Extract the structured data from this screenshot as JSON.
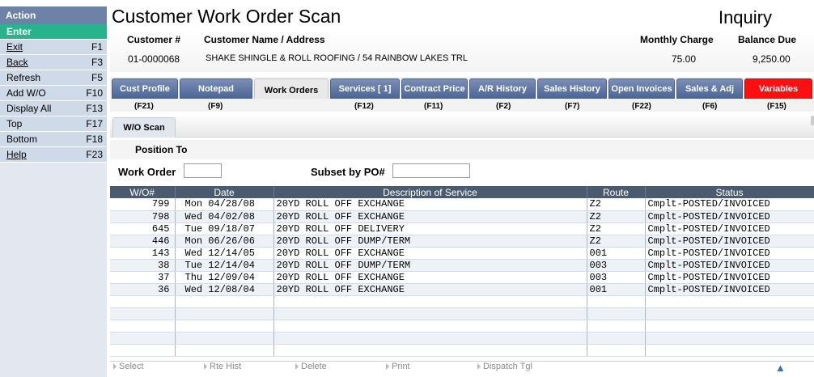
{
  "sidebar": {
    "header": "Action",
    "items": [
      {
        "label": "Enter",
        "key": ""
      },
      {
        "label": "Exit",
        "key": "F1"
      },
      {
        "label": "Back",
        "key": "F3"
      },
      {
        "label": "Refresh",
        "key": "F5"
      },
      {
        "label": "Add W/O",
        "key": "F10"
      },
      {
        "label": "Display All",
        "key": "F13"
      },
      {
        "label": "Top",
        "key": "F17"
      },
      {
        "label": "Bottom",
        "key": "F18"
      },
      {
        "label": "Help",
        "key": "F23"
      }
    ]
  },
  "header": {
    "title": "Customer Work Order Scan",
    "mode": "Inquiry"
  },
  "customer": {
    "labels": {
      "number": "Customer #",
      "name": "Customer Name / Address",
      "monthly": "Monthly Charge",
      "balance": "Balance Due"
    },
    "number": "01-0000068",
    "name_address": "SHAKE SHINGLE & ROLL ROOFING  /  54 RAINBOW LAKES TRL",
    "monthly_charge": "75.00",
    "balance_due": "9,250.00"
  },
  "tabs": [
    {
      "label": "Cust Profile",
      "key": "(F21)"
    },
    {
      "label": "Notepad",
      "key": "(F9)"
    },
    {
      "label": "Work Orders",
      "key": ""
    },
    {
      "label": "Services [    1]",
      "key": "(F12)"
    },
    {
      "label": "Contract Price",
      "key": "(F11)"
    },
    {
      "label": "A/R History",
      "key": "(F2)"
    },
    {
      "label": "Sales History",
      "key": "(F7)"
    },
    {
      "label": "Open Invoices",
      "key": "(F22)"
    },
    {
      "label": "Sales & Adj",
      "key": "(F6)"
    },
    {
      "label": "Variables",
      "key": "(F15)"
    }
  ],
  "subtab": "W/O Scan",
  "position_to": "Position To",
  "filters": {
    "work_order_label": "Work Order",
    "work_order_value": "",
    "subset_label": "Subset by PO#",
    "subset_value": ""
  },
  "grid": {
    "columns": [
      "W/O#",
      "Date",
      "Description of Service",
      "Route",
      "Status"
    ],
    "rows": [
      [
        "799",
        "Mon 04/28/08",
        "20YD ROLL OFF EXCHANGE",
        "Z2",
        "Cmplt-POSTED/INVOICED"
      ],
      [
        "798",
        "Wed 04/02/08",
        "20YD ROLL OFF EXCHANGE",
        "Z2",
        "Cmplt-POSTED/INVOICED"
      ],
      [
        "645",
        "Tue 09/18/07",
        "20YD ROLL OFF DELIVERY",
        "Z2",
        "Cmplt-POSTED/INVOICED"
      ],
      [
        "446",
        "Mon 06/26/06",
        "20YD ROLL OFF DUMP/TERM",
        "Z2",
        "Cmplt-POSTED/INVOICED"
      ],
      [
        "143",
        "Wed 12/14/05",
        "20YD ROLL OFF EXCHANGE",
        "001",
        "Cmplt-POSTED/INVOICED"
      ],
      [
        "38",
        "Tue 12/14/04",
        "20YD ROLL OFF DUMP/TERM",
        "003",
        "Cmplt-POSTED/INVOICED"
      ],
      [
        "37",
        "Thu 12/09/04",
        "20YD ROLL OFF EXCHANGE",
        "003",
        "Cmplt-POSTED/INVOICED"
      ],
      [
        "36",
        "Wed 12/08/04",
        "20YD ROLL OFF EXCHANGE",
        "001",
        "Cmplt-POSTED/INVOICED"
      ]
    ]
  },
  "footer": {
    "select": "Select",
    "rte_hist": "Rte Hist",
    "delete": "Delete",
    "print": "Print",
    "dispatch": "Dispatch Tgl"
  },
  "colors": {
    "sidebar_header": "#6d82a6",
    "enter": "#27b48b",
    "tab": "#5a719e",
    "variables_tab": "#ff1010",
    "grid_header": "#4a5b6f"
  }
}
